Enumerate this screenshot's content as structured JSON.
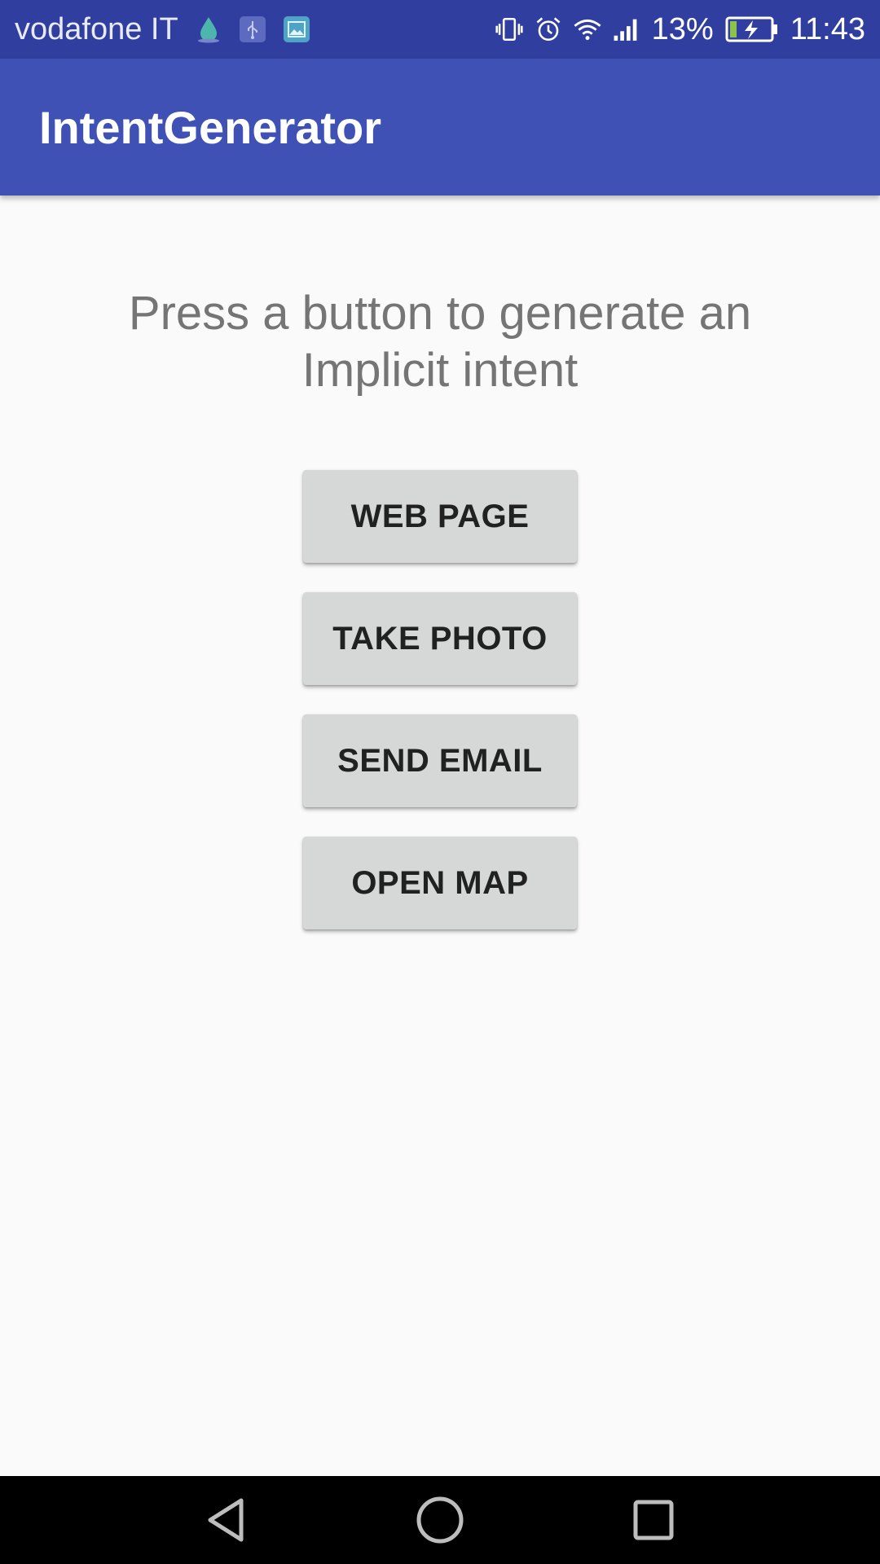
{
  "status_bar": {
    "carrier": "vodafone IT",
    "battery_percent": "13%",
    "time": "11:43",
    "left_icons": [
      "drop-icon",
      "usb-icon",
      "image-icon"
    ],
    "right_icons": [
      "vibrate-icon",
      "alarm-icon",
      "wifi-icon",
      "signal-icon",
      "battery-charging-icon"
    ]
  },
  "app_bar": {
    "title": "IntentGenerator"
  },
  "main": {
    "prompt": "Press a button to generate an Implicit intent",
    "buttons": [
      {
        "label": "WEB PAGE"
      },
      {
        "label": "TAKE PHOTO"
      },
      {
        "label": "SEND EMAIL"
      },
      {
        "label": "OPEN MAP"
      }
    ]
  },
  "nav_bar": {
    "icons": [
      "back-icon",
      "home-icon",
      "recents-icon"
    ]
  },
  "colors": {
    "status_bar": "#303f9f",
    "app_bar": "#3f51b5",
    "background": "#fafafa",
    "button": "#d6d7d7"
  }
}
